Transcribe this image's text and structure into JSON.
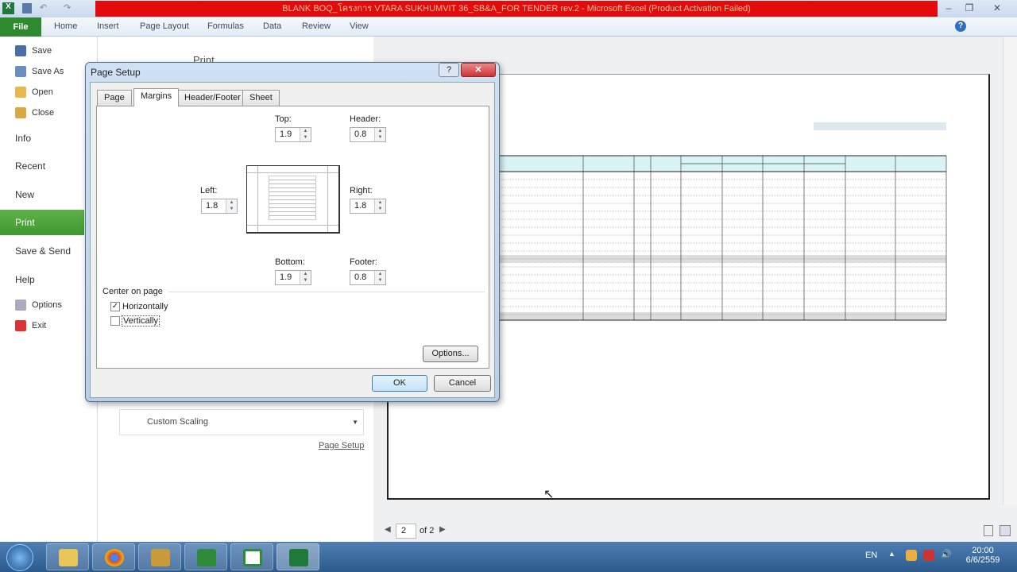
{
  "window": {
    "title": "BLANK BOQ_โครงการ VTARA SUKHUMVIT 36_SB&A_FOR TENDER rev.2 - Microsoft Excel (Product Activation Failed)"
  },
  "ribbon": {
    "file": "File",
    "tabs": [
      "Home",
      "Insert",
      "Page Layout",
      "Formulas",
      "Data",
      "Review",
      "View"
    ]
  },
  "nav": {
    "items": [
      "Save",
      "Save As",
      "Open",
      "Close",
      "Info",
      "Recent",
      "New",
      "Print",
      "Save & Send",
      "Help",
      "Options",
      "Exit"
    ],
    "selected": "Print"
  },
  "print_pane": {
    "heading": "Print",
    "scaling": "Custom Scaling",
    "page_setup_link": "Page Setup"
  },
  "preview_nav": {
    "current_page": "2",
    "of_label": "of 2"
  },
  "dialog": {
    "title": "Page Setup",
    "tabs": [
      "Page",
      "Margins",
      "Header/Footer",
      "Sheet"
    ],
    "active_tab": "Margins",
    "fields": {
      "top_label": "Top:",
      "top": "1.9",
      "header_label": "Header:",
      "header": "0.8",
      "left_label": "Left:",
      "left": "1.8",
      "right_label": "Right:",
      "right": "1.8",
      "bottom_label": "Bottom:",
      "bottom": "1.9",
      "footer_label": "Footer:",
      "footer": "0.8"
    },
    "center_on_page": "Center on page",
    "horizontally": {
      "label": "Horizontally",
      "checked": true
    },
    "vertically": {
      "label": "Vertically",
      "checked": false
    },
    "options_button": "Options...",
    "ok": "OK",
    "cancel": "Cancel"
  },
  "taskbar": {
    "language": "EN",
    "time": "20:00",
    "date": "6/6/2559"
  },
  "colors": {
    "title_bar_red": "#e30b0b",
    "file_tab": "#2f8a2f",
    "nav_selected": "#4fa83c",
    "table_header": "#d9f3f7"
  }
}
